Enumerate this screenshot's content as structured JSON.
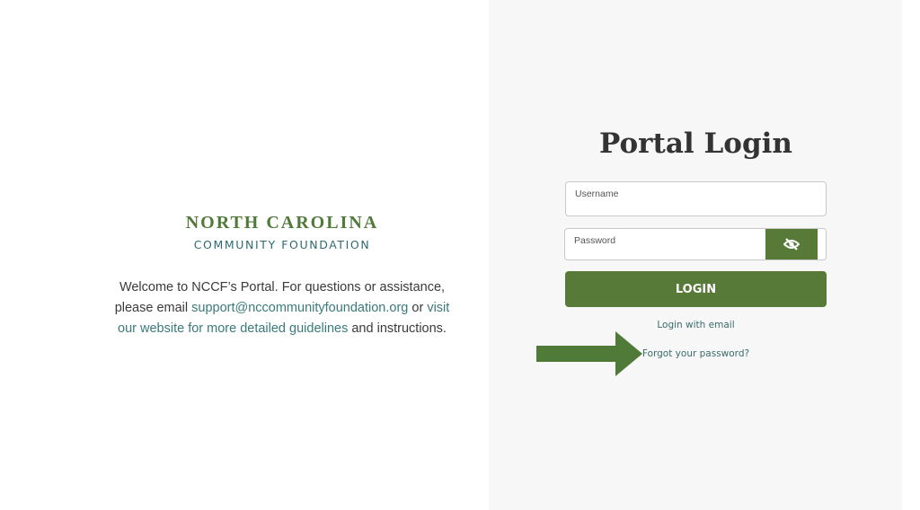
{
  "logo": {
    "line1": "NORTH CAROLINA",
    "line2": "COMMUNITY FOUNDATION",
    "colors": {
      "primary": "#4f7a38",
      "secondary": "#2f6a72"
    }
  },
  "welcome": {
    "text_before_email": "Welcome to NCCF’s Portal. For questions or assistance, please email ",
    "email_link": "support@nccommunityfoundation.org",
    "text_between": " or ",
    "website_link": "visit our website for more detailed guidelines",
    "text_after": " and instructions."
  },
  "login": {
    "title": "Portal Login",
    "username": {
      "label": "Username",
      "value": ""
    },
    "password": {
      "label": "Password",
      "value": ""
    },
    "toggle_icon": "eye-slash-icon",
    "submit_label": "LOGIN",
    "login_with_email_label": "Login with email",
    "forgot_password_label": "Forgot your password?"
  },
  "annotation": {
    "icon": "arrow-right-icon"
  },
  "colors": {
    "accent": "#577a39",
    "link": "#3a7a7a",
    "panel_background": "#f7f7f7",
    "text": "#333333"
  }
}
